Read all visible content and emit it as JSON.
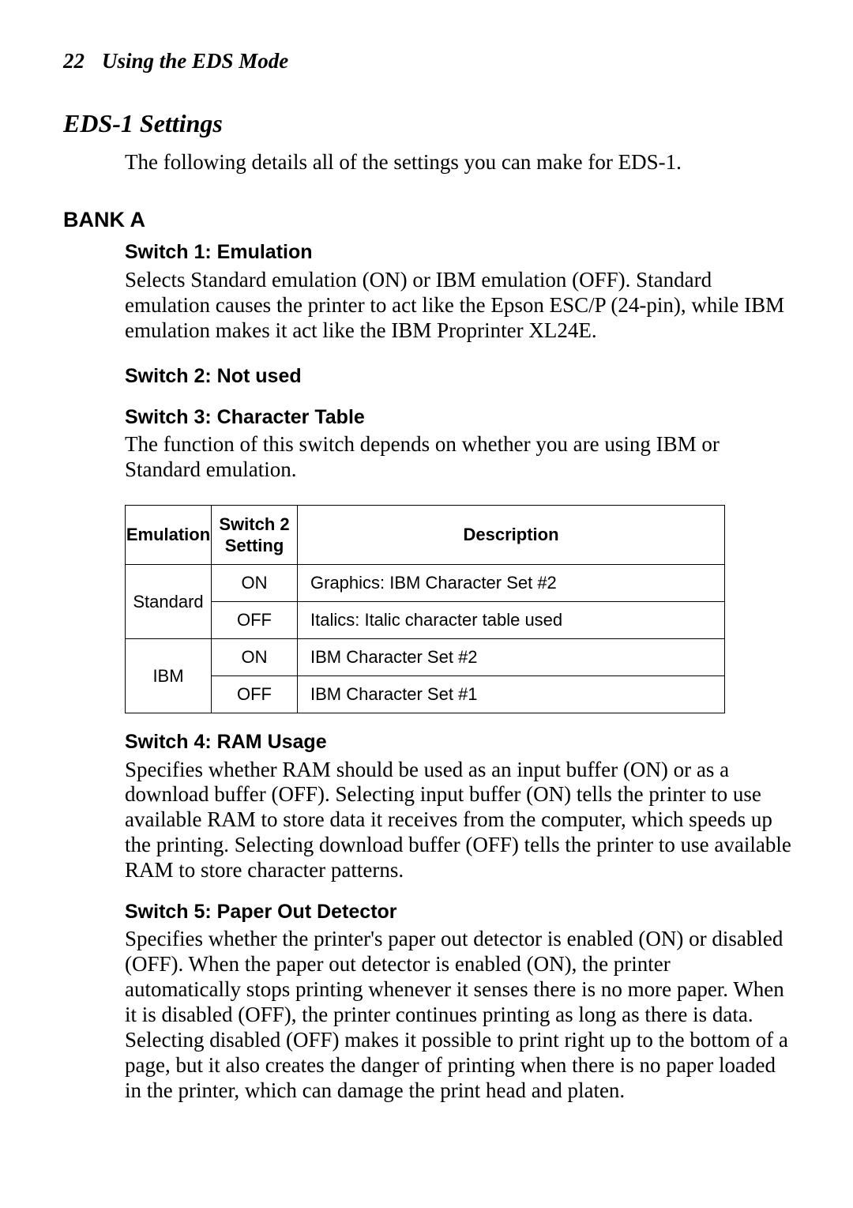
{
  "header": {
    "page_number": "22",
    "chapter_title": "Using the EDS Mode"
  },
  "section_heading": "EDS-1 Settings",
  "intro_text": "The following details all of the settings you can make for EDS-1.",
  "bank_heading": "BANK A",
  "switch1": {
    "title": "Switch 1: Emulation",
    "body": "Selects Standard emulation (ON) or IBM emulation (OFF). Standard emulation causes the printer to act like the Epson ESC/P (24-pin), while IBM emulation makes it act like the IBM Proprinter XL24E."
  },
  "switch2": {
    "title": "Switch 2: Not used"
  },
  "switch3": {
    "title": "Switch 3: Character Table",
    "body": "The function of this switch depends on whether you are using IBM or Standard emulation."
  },
  "table": {
    "headers": {
      "col1": "Emulation",
      "col2_line1": "Switch 2",
      "col2_line2": "Setting",
      "col3": "Description"
    },
    "rows": [
      {
        "emulation": "Standard",
        "setting": "ON",
        "desc": "Graphics: IBM Character Set #2"
      },
      {
        "emulation_rowspan_skip": true,
        "setting": "OFF",
        "desc": "Italics: Italic character table used"
      },
      {
        "emulation": "IBM",
        "setting": "ON",
        "desc": "IBM Character Set #2"
      },
      {
        "emulation_rowspan_skip": true,
        "setting": "OFF",
        "desc": "IBM Character Set #1"
      }
    ]
  },
  "switch4": {
    "title": "Switch 4: RAM Usage",
    "body": "Specifies whether RAM should be used as an input buffer (ON) or as a download buffer (OFF). Selecting input buffer (ON) tells the printer to use available RAM to store data it receives from the computer, which speeds up the printing. Selecting download buffer (OFF) tells the printer to use available RAM to store character patterns."
  },
  "switch5": {
    "title": "Switch 5: Paper Out Detector",
    "body": "Specifies whether the printer's paper out detector is enabled (ON) or disabled (OFF). When the paper out detector is enabled (ON), the printer automatically stops printing whenever it senses there is no more paper. When it is disabled (OFF), the printer continues printing as long as there is data. Selecting disabled (OFF) makes it possible to print right up to the bottom of a page, but it also creates the danger of printing when there is no paper loaded in the printer, which can damage the print head and platen."
  }
}
